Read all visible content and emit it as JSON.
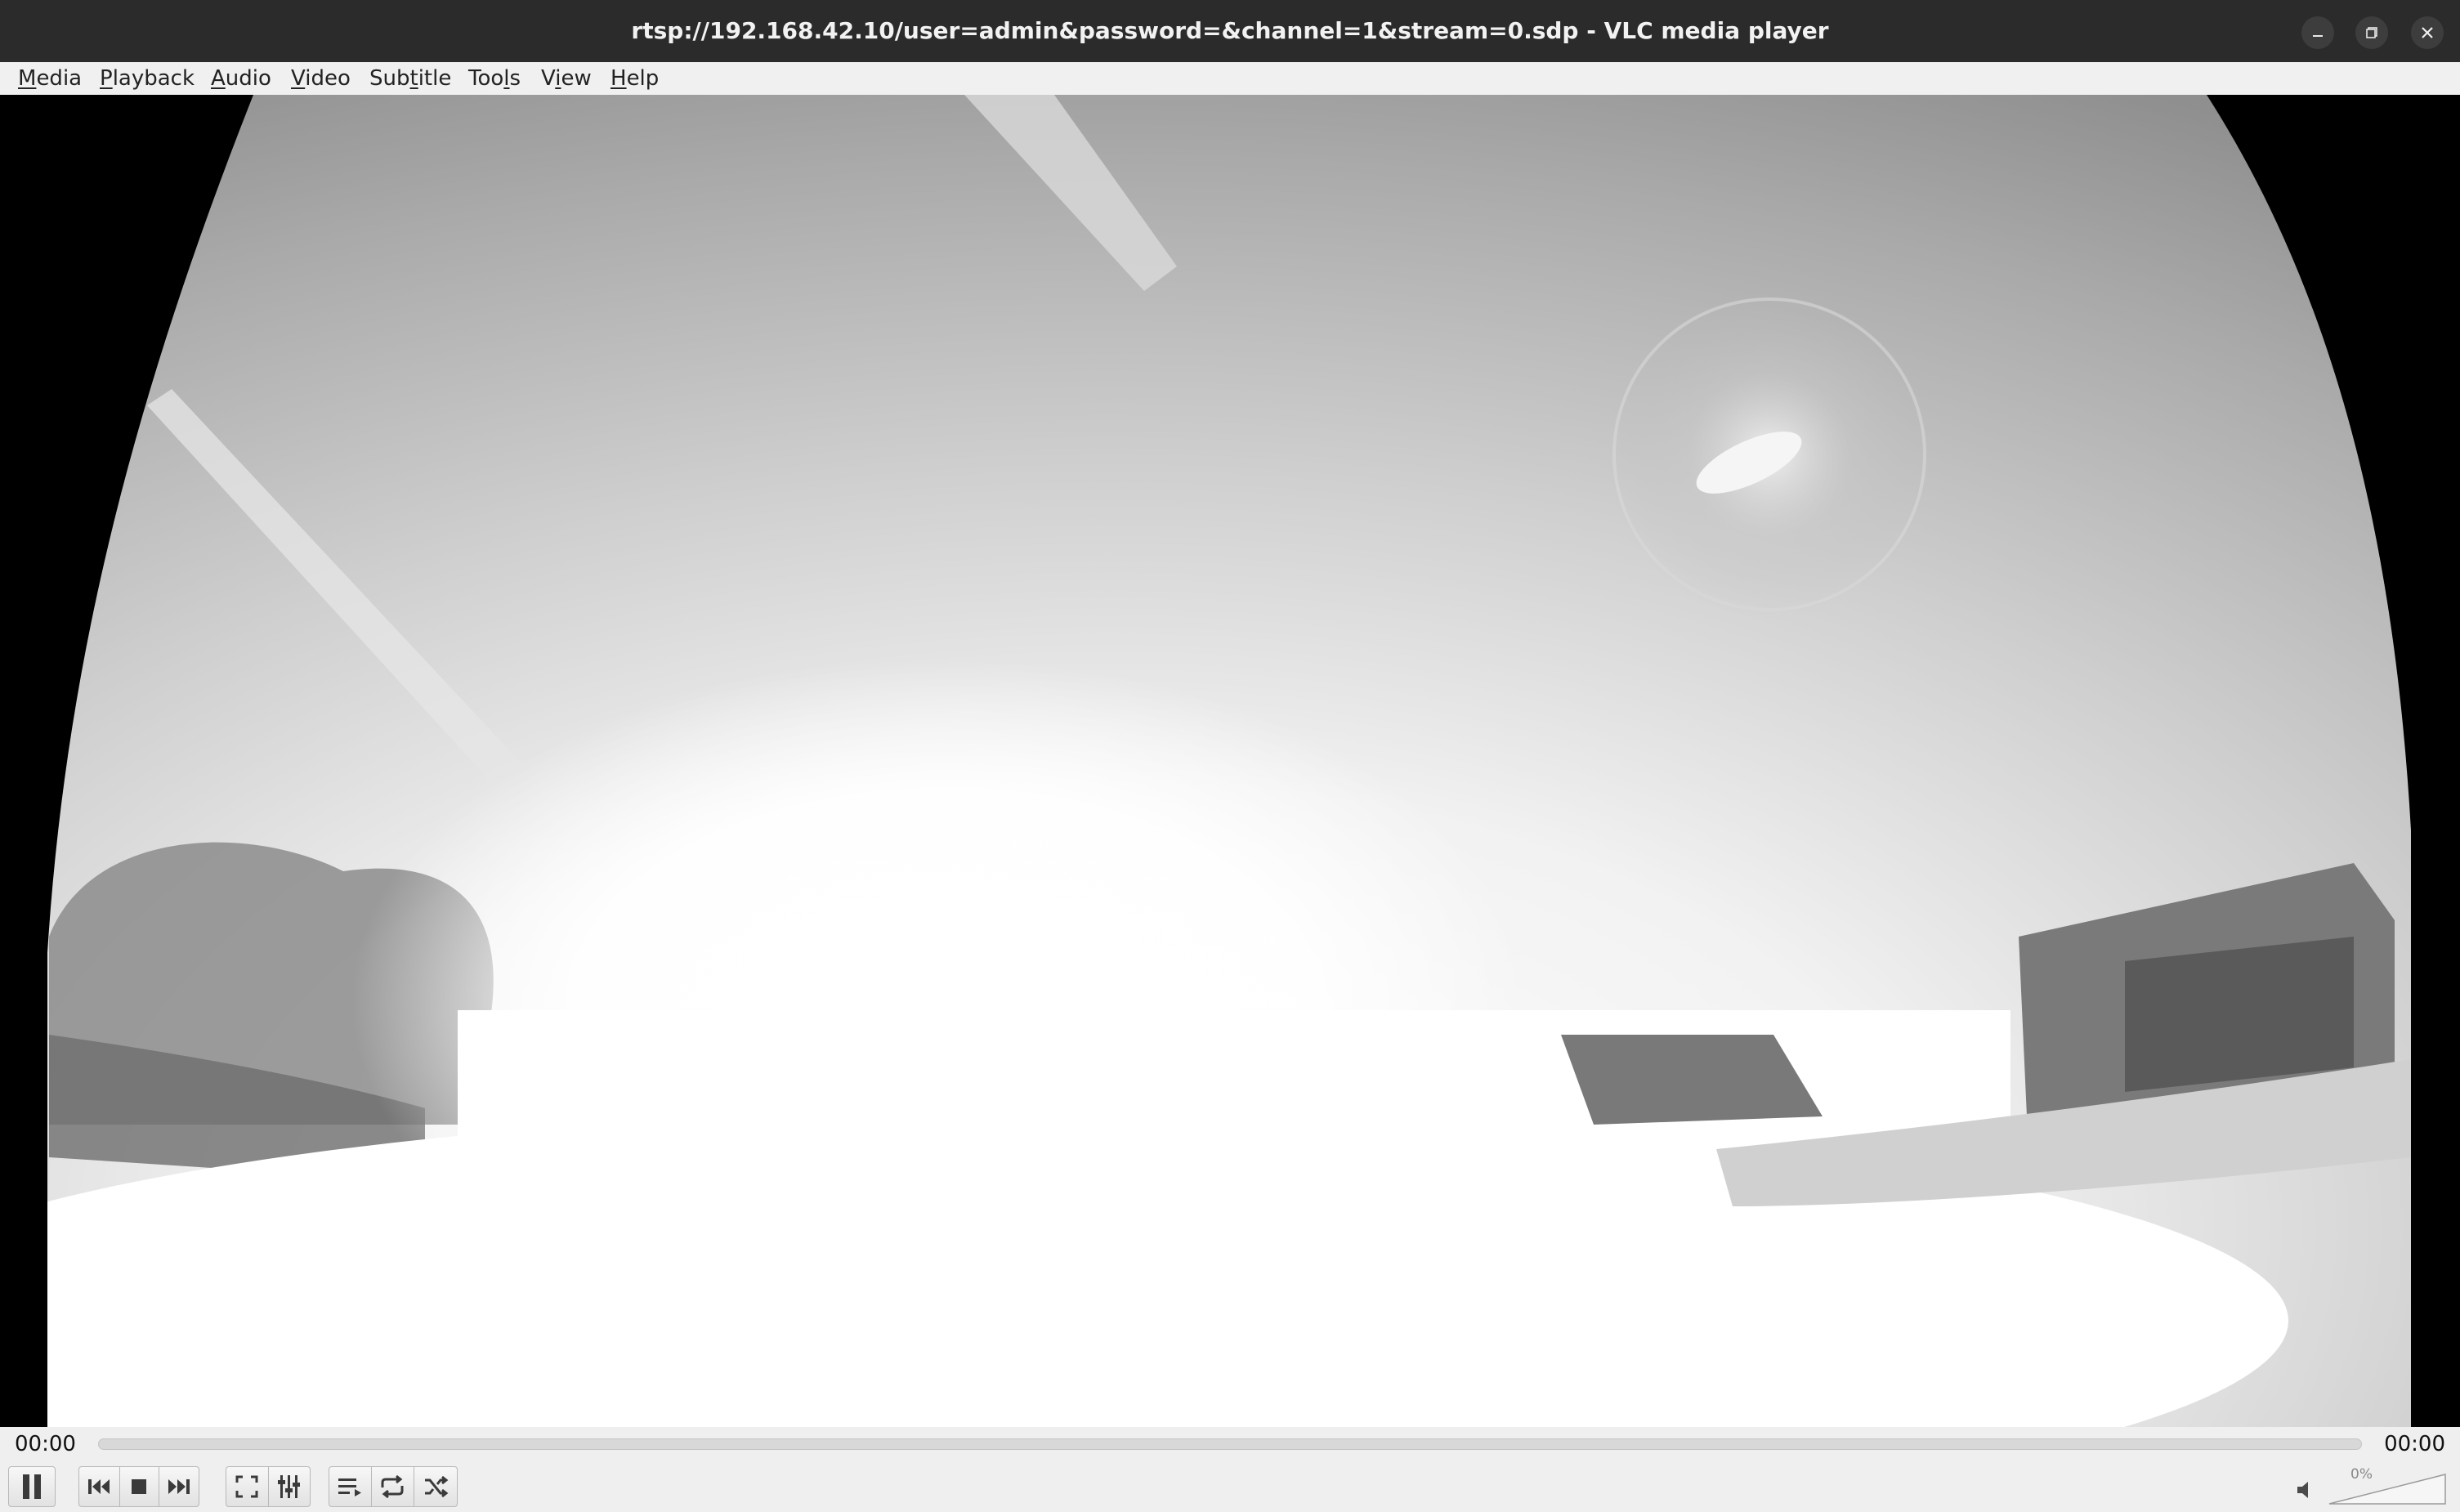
{
  "window": {
    "title": "rtsp://192.168.42.10/user=admin&password=&channel=1&stream=0.sdp - VLC media player",
    "buttons": [
      {
        "name": "minimize",
        "icon": "minimize-icon"
      },
      {
        "name": "maximize",
        "icon": "restore-icon"
      },
      {
        "name": "close",
        "icon": "close-icon"
      }
    ]
  },
  "menu": {
    "items": [
      {
        "label": "Media",
        "mnemonic": "M",
        "rest": "edia"
      },
      {
        "label": "Playback",
        "mnemonic": "P",
        "rest": "layback"
      },
      {
        "label": "Audio",
        "mnemonic": "A",
        "rest": "udio"
      },
      {
        "label": "Video",
        "mnemonic": "V",
        "rest": "ideo"
      },
      {
        "label": "Subtitle",
        "pre": "Sub",
        "mnemonic": "t",
        "rest": "itle"
      },
      {
        "label": "Tools",
        "pre": "Too",
        "mnemonic": "l",
        "rest": "s"
      },
      {
        "label": "View",
        "pre": "V",
        "mnemonic": "i",
        "rest": "ew"
      },
      {
        "label": "Help",
        "mnemonic": "H",
        "rest": "elp"
      }
    ]
  },
  "video": {
    "description_icon": "camera-fisheye-frame"
  },
  "seek": {
    "elapsed": "00:00",
    "total": "00:00",
    "progress": 0
  },
  "controls": {
    "buttons": [
      {
        "name": "pause",
        "icon": "pause-icon"
      },
      {
        "name": "previous",
        "icon": "previous-icon"
      },
      {
        "name": "stop",
        "icon": "stop-icon"
      },
      {
        "name": "next",
        "icon": "next-icon"
      },
      {
        "name": "fullscreen",
        "icon": "fullscreen-icon"
      },
      {
        "name": "extended-settings",
        "icon": "equalizer-icon"
      },
      {
        "name": "playlist",
        "icon": "playlist-icon"
      },
      {
        "name": "loop",
        "icon": "loop-icon"
      },
      {
        "name": "random",
        "icon": "shuffle-icon"
      }
    ],
    "volume": {
      "icon": "speaker-icon",
      "percent_label": "0%",
      "level": 0
    }
  },
  "colors": {
    "titlebar": "#2b2b2b",
    "accent": "#5a8fd0"
  }
}
